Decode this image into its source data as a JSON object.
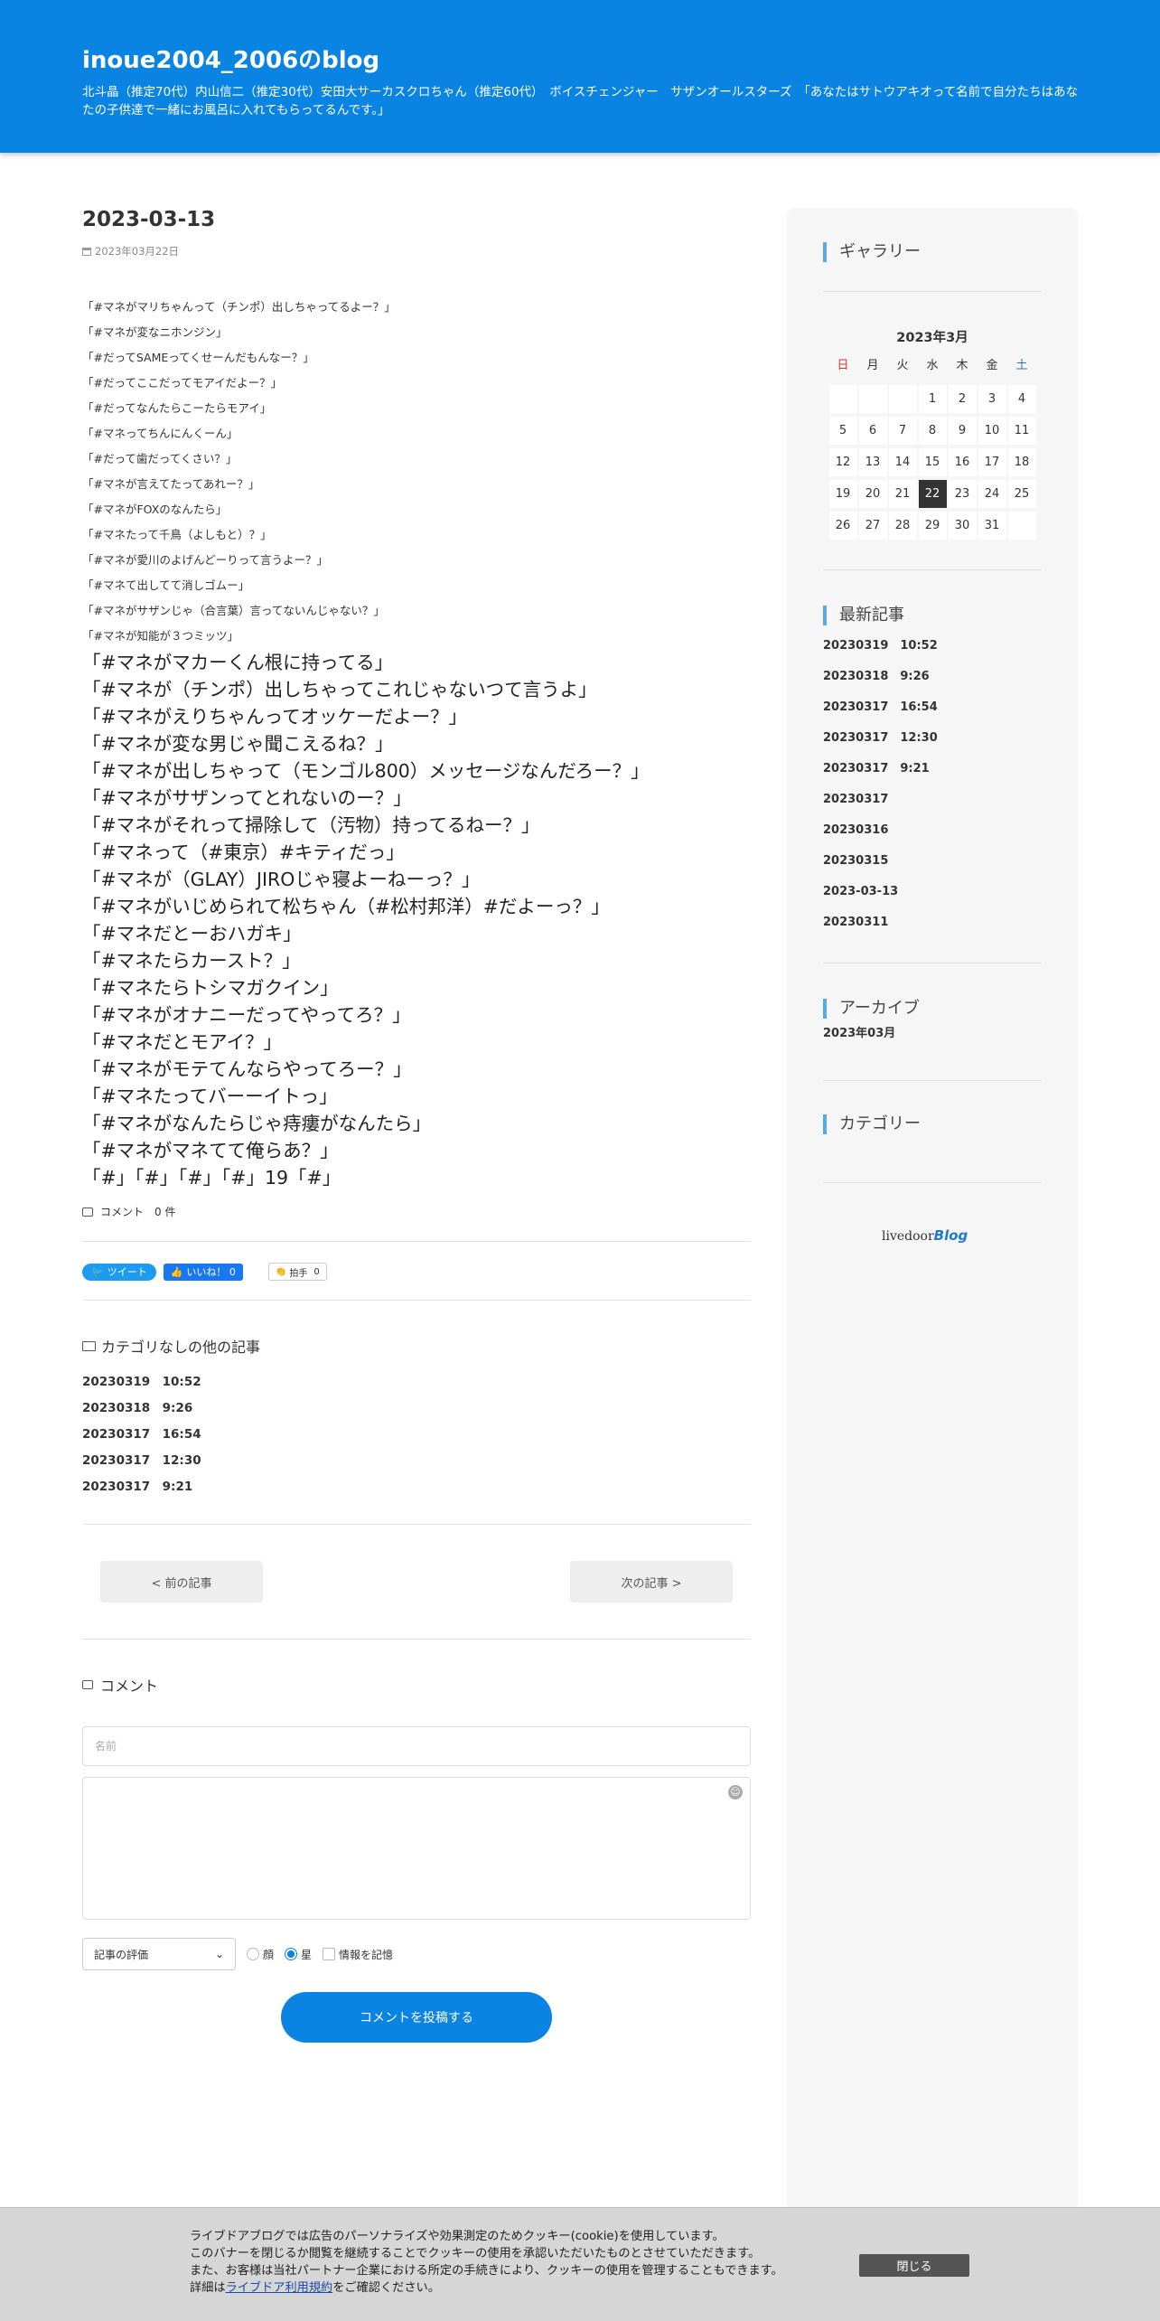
{
  "header": {
    "title": "inoue2004_2006のblog",
    "description": "北斗晶（推定70代）内山信二（推定30代）安田大サーカスクロちゃん（推定60代）　ボイスチェンジャー　サザンオールスターズ　「あなたはサトウアキオって名前で自分たちはあなたの子供達で一緒にお風呂に入れてもらってるんです。」"
  },
  "post": {
    "title": "2023-03-13",
    "date": "2023年03月22日",
    "small_lines": [
      "「#マネがマリちゃんって（チンポ）出しちゃってるよー？」",
      "「#マネが変なニホンジン」",
      "「#だってSAMEってくせーんだもんなー？」",
      "「#だってここだってモアイだよー？」",
      "「#だってなんたらこーたらモアイ」",
      "「#マネってちんにんくーん」",
      "「#だって歯だってくさい？」",
      "「#マネが言えてたってあれー？」",
      "「#マネがFOXのなんたら」",
      "「#マネたって千鳥（よしもと）？」",
      "「#マネが愛川のよげんどーりって言うよー？」",
      "「#マネて出してて消しゴムー」",
      "「#マネがサザンじゃ（合言葉）言ってないんじゃない？」",
      "「#マネが知能が３つミッツ」"
    ],
    "big_lines": [
      "「#マネがマカーくん根に持ってる」",
      "「#マネが（チンポ）出しちゃってこれじゃないつて言うよ」",
      "「#マネがえりちゃんってオッケーだよー？」",
      "「#マネが変な男じゃ聞こえるね？」",
      "「#マネが出しちゃって（モンゴル800）メッセージなんだろー？」",
      "「#マネがサザンってとれないのー？」",
      "「#マネがそれって掃除して（汚物）持ってるねー？」",
      "「#マネって（#東京）#キティだっ」",
      "「#マネが（GLAY）JIROじゃ寝よーねーっ？」",
      "「#マネがいじめられて松ちゃん（#松村邦洋）#だよーっ？」",
      "「#マネだとーおハガキ」",
      "「#マネたらカースト？」",
      "「#マネたらトシマガクイン」",
      "「#マネがオナニーだってやってろ？」",
      "「#マネだとモアイ？」",
      "「#マネがモテてんならやってろー？」",
      "「#マネたってバーーイトっ」",
      "「#マネがなんたらじゃ痔瘻がなんたら」",
      "「#マネがマネてて俺らあ？」",
      "「#」「#」「#」「#」19「#」"
    ],
    "comment_count": "コメント　0 件"
  },
  "social": {
    "tweet": "ツイート",
    "like": "いいね！ 0",
    "clap": "拍手",
    "clap_count": "0"
  },
  "related": {
    "title": "カテゴリなしの他の記事",
    "items": [
      "20230319　10:52",
      "20230318　9:26",
      "20230317　16:54",
      "20230317　12:30",
      "20230317　9:21"
    ]
  },
  "pager": {
    "prev": "< 前の記事",
    "next": "次の記事 >"
  },
  "comment_form": {
    "heading": "コメント",
    "name_placeholder": "名前",
    "rating_select": "記事の評価",
    "opt_face": "顔",
    "opt_star": "星",
    "opt_remember": "情報を記憶",
    "submit": "コメントを投稿する"
  },
  "sidebar": {
    "gallery_title": "ギャラリー",
    "calendar": {
      "title": "2023年3月",
      "weekdays": [
        "日",
        "月",
        "火",
        "水",
        "木",
        "金",
        "土"
      ],
      "weeks": [
        [
          "",
          "",
          "",
          "1",
          "2",
          "3",
          "4"
        ],
        [
          "5",
          "6",
          "7",
          "8",
          "9",
          "10",
          "11"
        ],
        [
          "12",
          "13",
          "14",
          "15",
          "16",
          "17",
          "18"
        ],
        [
          "19",
          "20",
          "21",
          "22",
          "23",
          "24",
          "25"
        ],
        [
          "26",
          "27",
          "28",
          "29",
          "30",
          "31",
          ""
        ]
      ],
      "highlighted_day": "22"
    },
    "recent_title": "最新記事",
    "recent_items": [
      "20230319　10:52",
      "20230318　9:26",
      "20230317　16:54",
      "20230317　12:30",
      "20230317　9:21",
      "20230317",
      "20230316",
      "20230315",
      "2023-03-13",
      "20230311"
    ],
    "archive_title": "アーカイブ",
    "archive_items": [
      "2023年03月"
    ],
    "category_title": "カテゴリー",
    "logo_text": "livedoor",
    "logo_blog": "Blog"
  },
  "cookie": {
    "line1": "ライブドアブログでは広告のパーソナライズや効果測定のためクッキー(cookie)を使用しています。",
    "line2": "このバナーを閉じるか閲覧を継続することでクッキーの使用を承認いただいたものとさせていただきます。",
    "line3": "また、お客様は当社パートナー企業における所定の手続きにより、クッキーの使用を管理することもできます。",
    "line4_pre": "詳細は",
    "line4_link": "ライブドア利用規約",
    "line4_post": "をご確認ください。",
    "close": "閉じる"
  },
  "colors": {
    "accent": "#0a84e3",
    "sidebar_bar": "#58a9e8"
  }
}
